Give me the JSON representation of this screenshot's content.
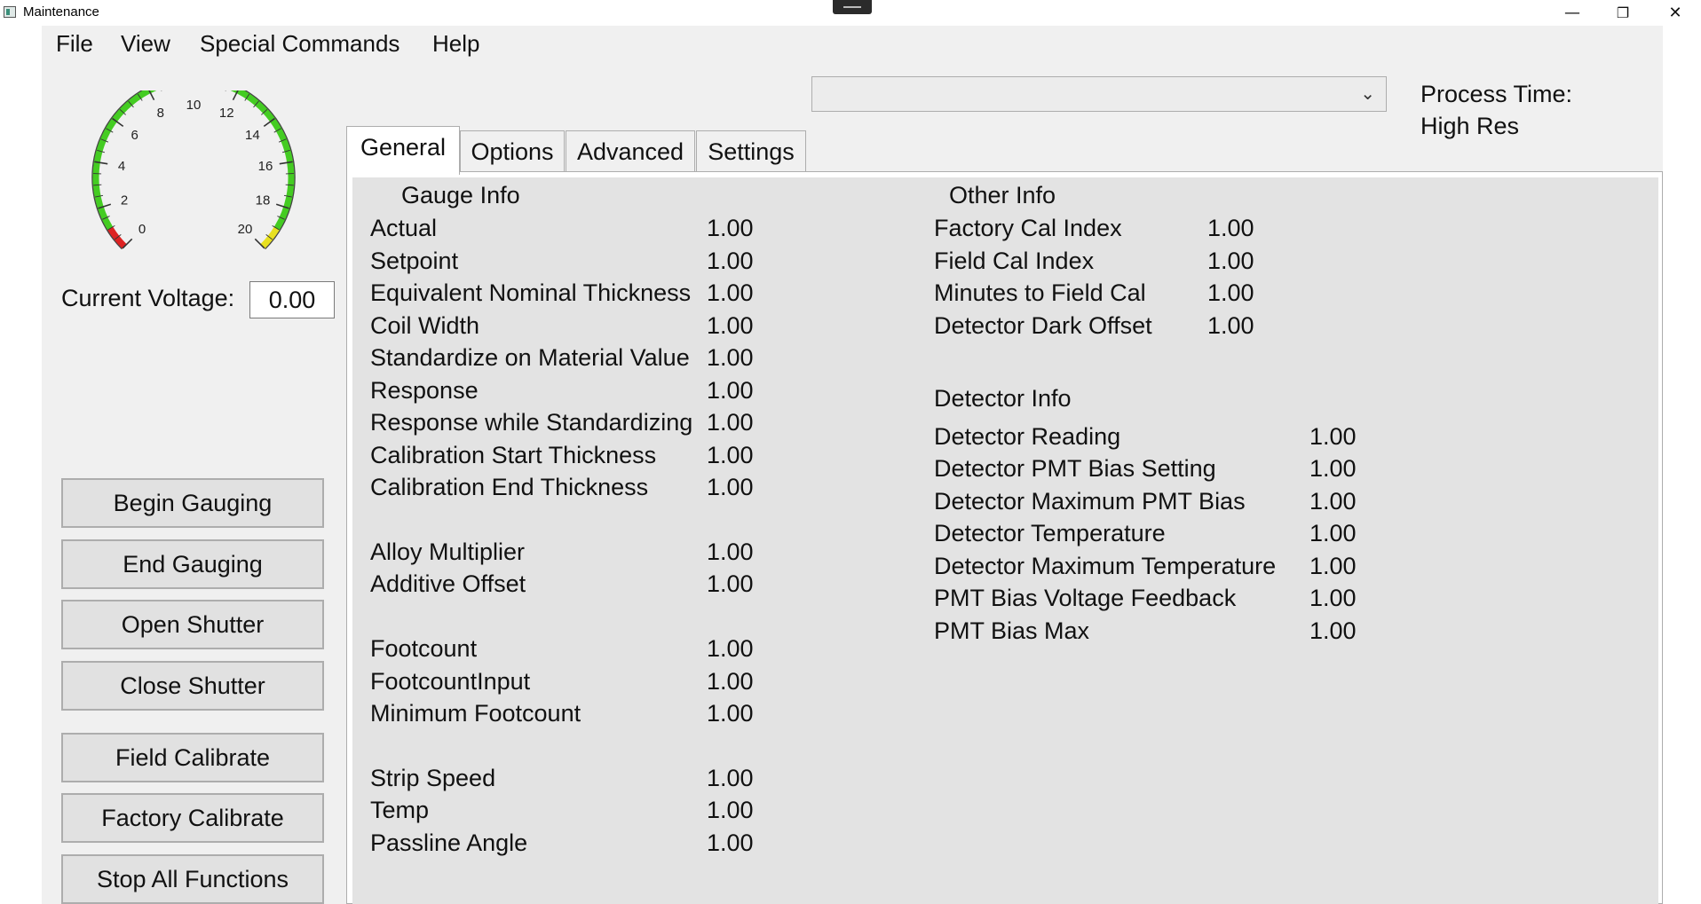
{
  "window": {
    "title": "Maintenance",
    "controls": {
      "minimize": "—",
      "restore": "❐",
      "close": "✕"
    }
  },
  "menu": [
    "File",
    "View",
    "Special Commands",
    "Help"
  ],
  "gauge": {
    "ticks": [
      "0",
      "2",
      "4",
      "6",
      "8",
      "10",
      "12",
      "14",
      "16",
      "18",
      "20"
    ],
    "colors": {
      "green": "#44cc22",
      "red": "#dd2222",
      "yellow": "#e8e020"
    }
  },
  "voltage": {
    "label": "Current Voltage:",
    "value": "0.00"
  },
  "buttons": [
    "Begin Gauging",
    "End Gauging",
    "Open Shutter",
    "Close Shutter",
    "Field Calibrate",
    "Factory Calibrate",
    "Stop All Functions"
  ],
  "header": {
    "dropdown_value": "",
    "process_time_label": "Process Time:",
    "resolution": "High Res"
  },
  "tabs": [
    "General",
    "Options",
    "Advanced",
    "Settings"
  ],
  "general": {
    "gauge_info": {
      "title": "Gauge Info",
      "rows": [
        {
          "label": "Actual",
          "value": "1.00"
        },
        {
          "label": "Setpoint",
          "value": "1.00"
        },
        {
          "label": "Equivalent Nominal Thickness",
          "value": "1.00"
        },
        {
          "label": "Coil Width",
          "value": "1.00"
        },
        {
          "label": "Standardize on Material Value",
          "value": "1.00"
        },
        {
          "label": "Response",
          "value": "1.00"
        },
        {
          "label": "Response while Standardizing",
          "value": "1.00"
        },
        {
          "label": "Calibration Start Thickness",
          "value": "1.00"
        },
        {
          "label": "Calibration End Thickness",
          "value": "1.00"
        },
        {
          "label": "Alloy Multiplier",
          "value": "1.00"
        },
        {
          "label": "Additive Offset",
          "value": "1.00"
        },
        {
          "label": "Footcount",
          "value": "1.00"
        },
        {
          "label": "FootcountInput",
          "value": "1.00"
        },
        {
          "label": "Minimum Footcount",
          "value": "1.00"
        },
        {
          "label": "Strip Speed",
          "value": "1.00"
        },
        {
          "label": "Temp",
          "value": "1.00"
        },
        {
          "label": "Passline Angle",
          "value": "1.00"
        }
      ]
    },
    "other_info": {
      "title": "Other Info",
      "rows": [
        {
          "label": "Factory Cal Index",
          "value": "1.00"
        },
        {
          "label": "Field Cal Index",
          "value": "1.00"
        },
        {
          "label": "Minutes to Field Cal",
          "value": "1.00"
        },
        {
          "label": "Detector Dark Offset",
          "value": "1.00"
        }
      ]
    },
    "detector_info": {
      "title": "Detector Info",
      "rows": [
        {
          "label": "Detector Reading",
          "value": "1.00"
        },
        {
          "label": "Detector PMT Bias Setting",
          "value": "1.00"
        },
        {
          "label": "Detector Maximum PMT Bias",
          "value": "1.00"
        },
        {
          "label": "Detector Temperature",
          "value": "1.00"
        },
        {
          "label": "Detector Maximum Temperature",
          "value": "1.00"
        },
        {
          "label": "PMT Bias Voltage Feedback",
          "value": "1.00"
        },
        {
          "label": "PMT Bias Max",
          "value": "1.00"
        }
      ]
    }
  }
}
